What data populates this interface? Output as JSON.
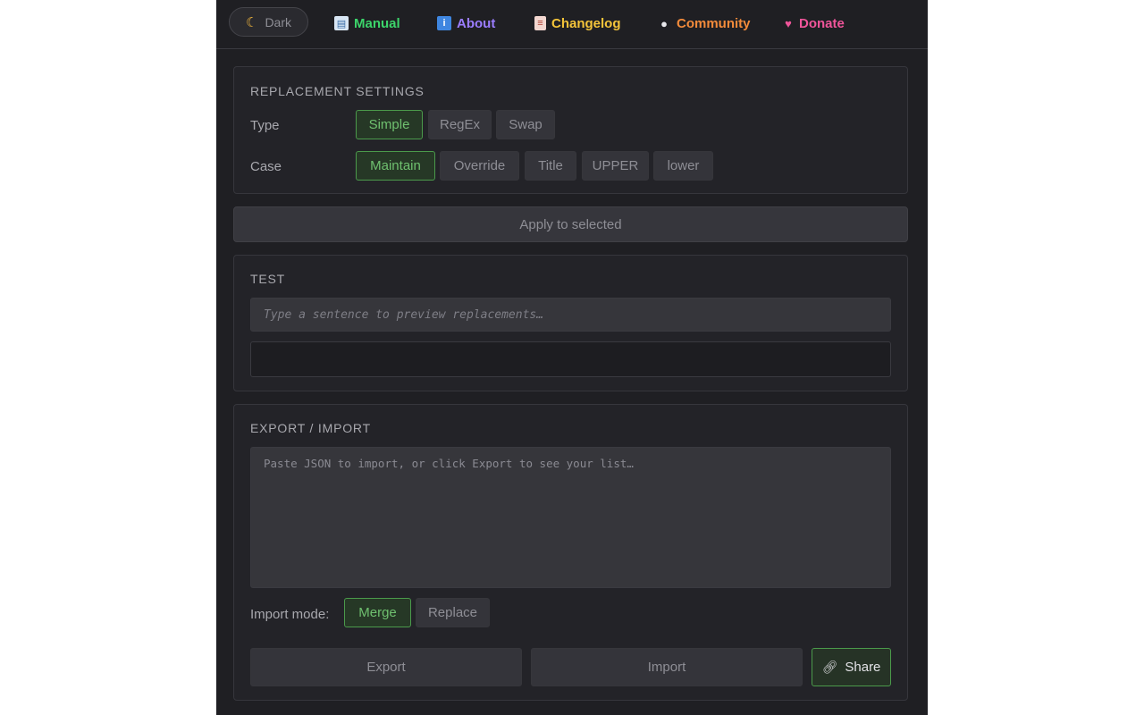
{
  "nav": {
    "theme_label": "Dark",
    "theme_icon": "moon-icon",
    "links": [
      {
        "label": "Manual",
        "icon": "book-icon",
        "color": "#3cd46a"
      },
      {
        "label": "About",
        "icon": "info-icon",
        "color": "#9b7dff"
      },
      {
        "label": "Changelog",
        "icon": "clipboard-icon",
        "color": "#f4c43a"
      },
      {
        "label": "Community",
        "icon": "speech-bubble-icon",
        "color": "#f38b3b"
      },
      {
        "label": "Donate",
        "icon": "heart-icon",
        "color": "#f0559a"
      }
    ]
  },
  "replacement_settings": {
    "title": "REPLACEMENT SETTINGS",
    "type_label": "Type",
    "type_options": [
      "Simple",
      "RegEx",
      "Swap"
    ],
    "type_selected": "Simple",
    "case_label": "Case",
    "case_options": [
      "Maintain",
      "Override",
      "Title",
      "UPPER",
      "lower"
    ],
    "case_selected": "Maintain"
  },
  "apply_label": "Apply to selected",
  "test": {
    "title": "TEST",
    "input_placeholder": "Type a sentence to preview replacements…",
    "output_value": ""
  },
  "export_import": {
    "title": "EXPORT / IMPORT",
    "textarea_placeholder": "Paste JSON to import, or click Export to see your list…",
    "import_mode_label": "Import mode:",
    "import_mode_options": [
      "Merge",
      "Replace"
    ],
    "import_mode_selected": "Merge",
    "export_label": "Export",
    "import_label": "Import",
    "share_label": "Share",
    "share_icon": "link-icon"
  },
  "colors": {
    "accent_green": "#4b9a4b",
    "background": "#1f1f23",
    "panel": "#232328"
  }
}
